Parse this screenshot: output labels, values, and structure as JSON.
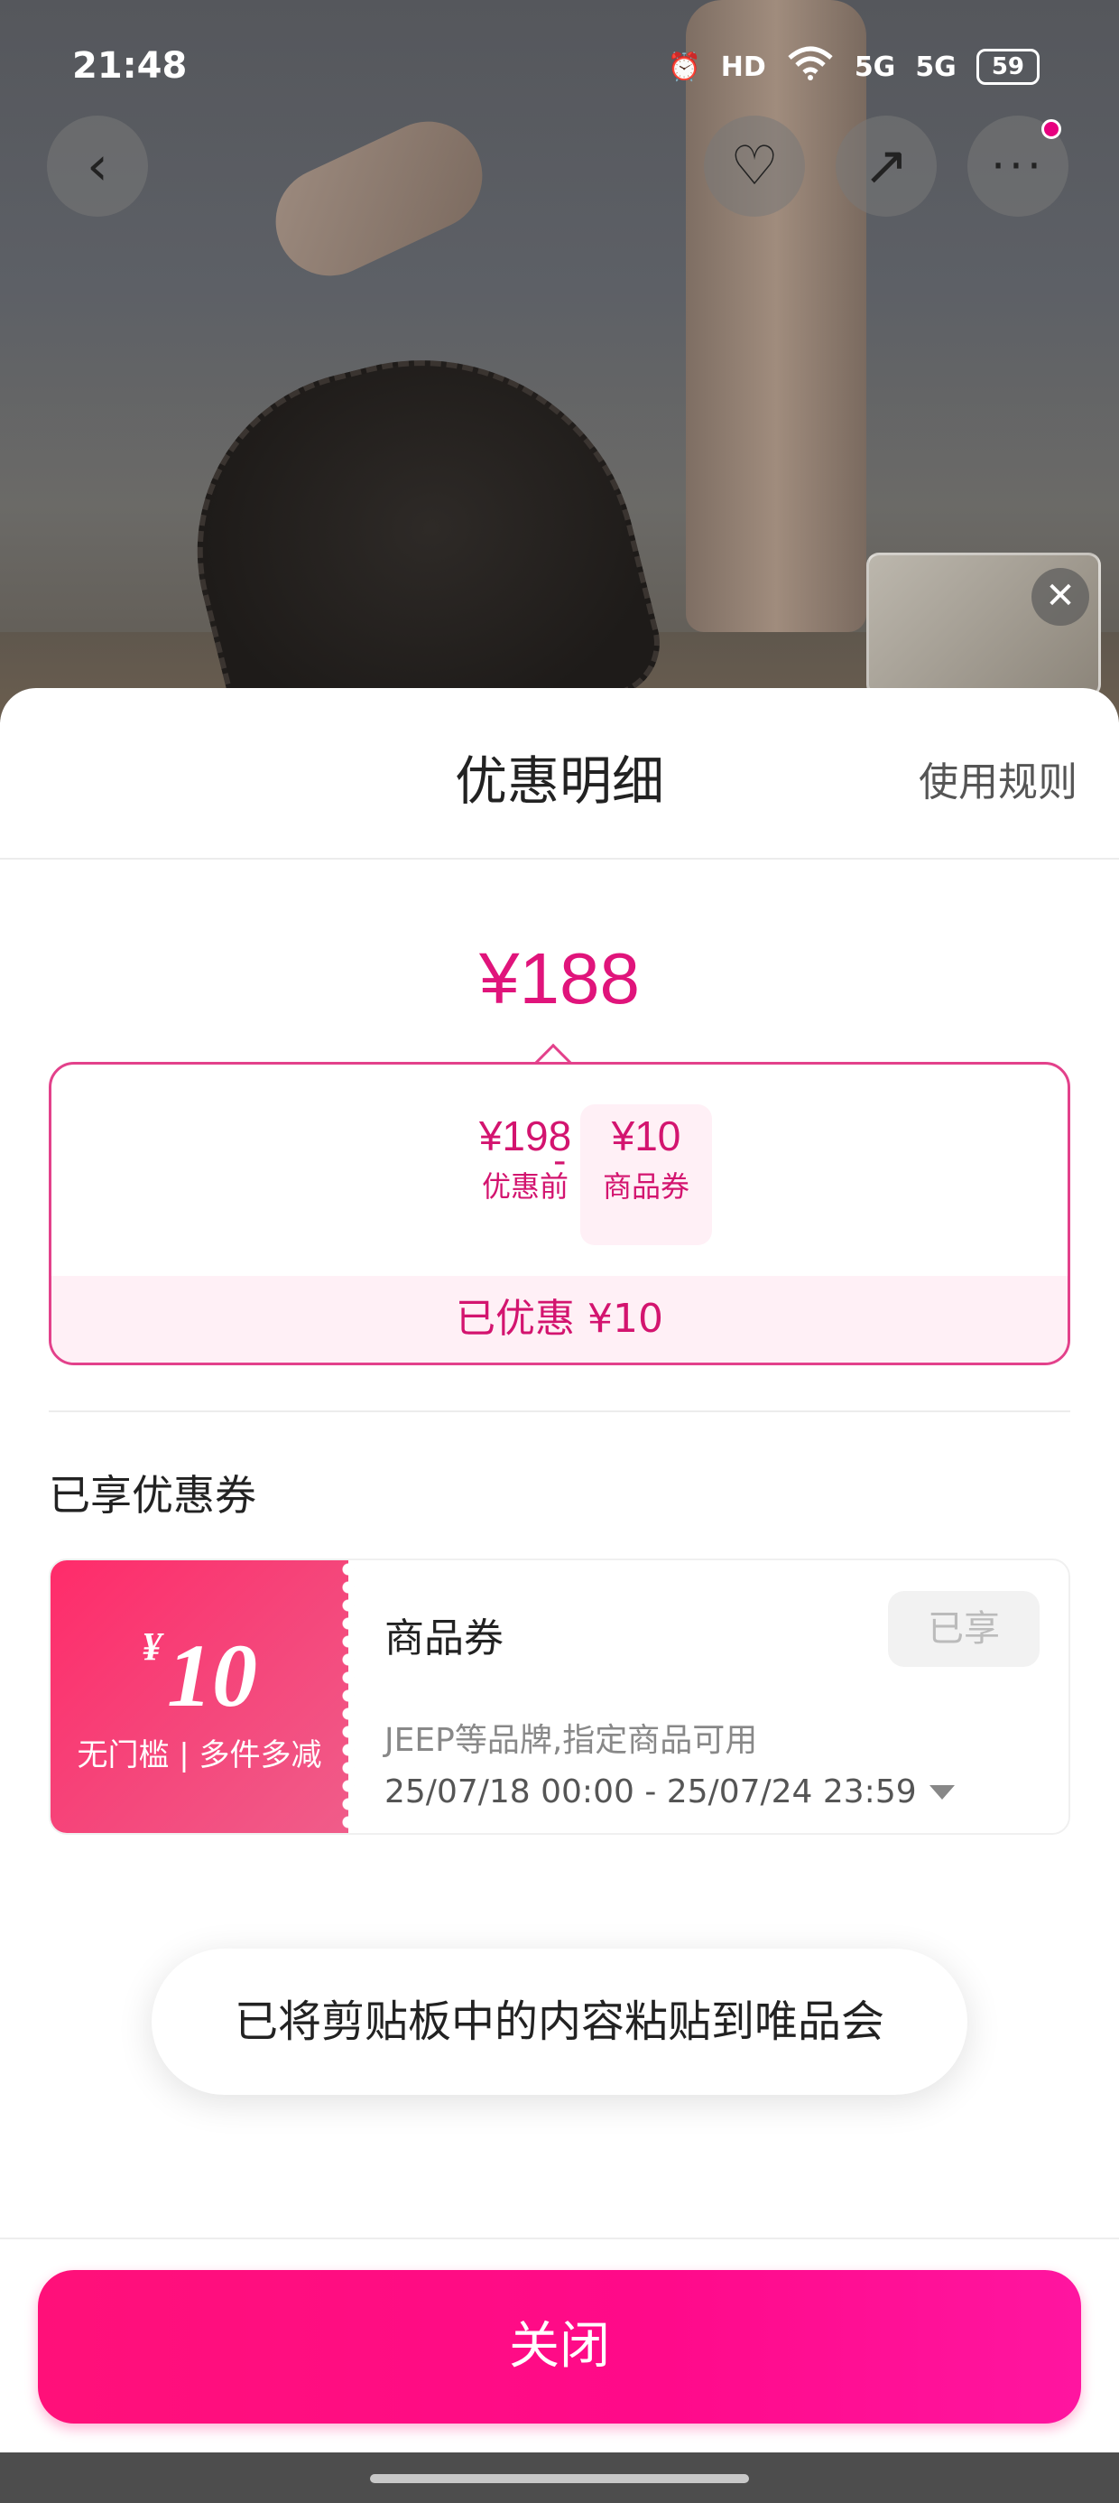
{
  "status_bar": {
    "time": "21:48",
    "icons": [
      "alarm-icon",
      "hd-icon",
      "wifi-icon",
      "signal-5g-icon",
      "signal-5g-icon"
    ],
    "hd_label": "HD",
    "signal_1": "5G",
    "signal_2": "5G",
    "battery": "59"
  },
  "top_nav": {
    "back_icon": "‹",
    "favorite_icon": "♡",
    "share_icon": "↗",
    "more_icon": "···"
  },
  "mini_video": {
    "close_icon": "✕"
  },
  "sheet": {
    "title": "优惠明细",
    "rules_link": "使用规则",
    "final_price": "¥188",
    "calculation": {
      "original_value": "¥198",
      "original_label": "优惠前",
      "operator": "-",
      "coupon_value": "¥10",
      "coupon_label": "商品券",
      "saved_text": "已优惠 ¥10"
    },
    "section_title": "已享优惠券",
    "coupon": {
      "currency": "¥",
      "amount": "10",
      "condition": "无门槛 | 多件多减",
      "name": "商品券",
      "status_badge": "已享",
      "scope": "JEEP等品牌,指定商品可用",
      "period": "25/07/18 00:00 - 25/07/24 23:59"
    },
    "close_button": "关闭"
  },
  "toast": {
    "message": "已将剪贴板中的内容粘贴到唯品会"
  },
  "colors": {
    "accent": "#e0147b",
    "button": "#ff1079",
    "coupon_bg": "#ff2b6a"
  }
}
